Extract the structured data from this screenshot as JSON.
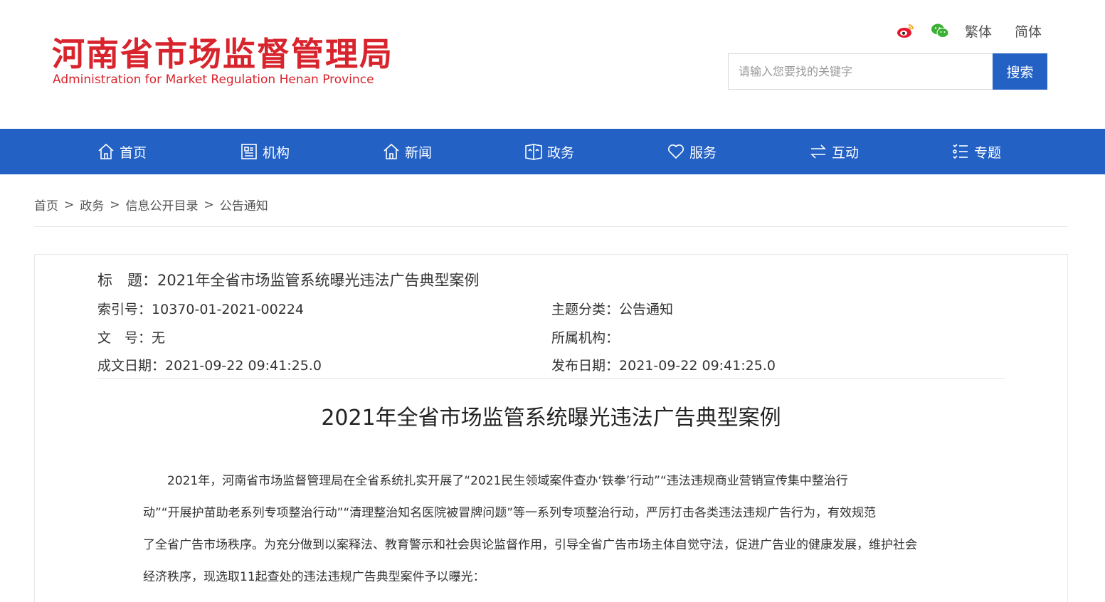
{
  "header": {
    "logo_cn": "河南省市场监督管理局",
    "logo_en": "Administration for Market Regulation Henan Province",
    "lang_traditional": "繁体",
    "lang_simplified": "简体",
    "search_placeholder": "请输入您要找的关键字",
    "search_button": "搜索"
  },
  "colors": {
    "brand_red": "#d8242c",
    "nav_blue": "#2361c5"
  },
  "nav": {
    "items": [
      {
        "label": "首页",
        "icon": "home-icon"
      },
      {
        "label": "机构",
        "icon": "document-icon"
      },
      {
        "label": "新闻",
        "icon": "news-home-icon"
      },
      {
        "label": "政务",
        "icon": "shield-badge-icon"
      },
      {
        "label": "服务",
        "icon": "heart-icon"
      },
      {
        "label": "互动",
        "icon": "exchange-arrows-icon"
      },
      {
        "label": "专题",
        "icon": "list-icon"
      }
    ]
  },
  "breadcrumb": {
    "items": [
      "首页",
      "政务",
      "信息公开目录",
      "公告通知"
    ],
    "separator": ">"
  },
  "meta": {
    "title_label": "标　题：",
    "title_value": "2021年全省市场监管系统曝光违法广告典型案例",
    "index_label": "索引号：",
    "index_value": "10370-01-2021-00224",
    "category_label": "主题分类：",
    "category_value": "公告通知",
    "docno_label": "文　号：",
    "docno_value": "无",
    "org_label": "所属机构：",
    "org_value": "",
    "created_label": "成文日期：",
    "created_value": "2021-09-22 09:41:25.0",
    "published_label": "发布日期：",
    "published_value": "2021-09-22 09:41:25.0"
  },
  "article": {
    "title": "2021年全省市场监管系统曝光违法广告典型案例",
    "lines": [
      "　　2021年，河南省市场监督管理局在全省系统扎实开展了“2021民生领域案件查办‘铁拳’行动”“违法违规商业营销宣传集中整治行",
      "动”“开展护苗助老系列专项整治行动”“清理整治知名医院被冒牌问题”等一系列专项整治行动，严厉打击各类违法违规广告行为，有效规范",
      "了全省广告市场秩序。为充分做到以案释法、教育警示和社会舆论监督作用，引导全省广告市场主体自觉守法，促进广告业的健康发展，维护社会",
      "经济秩序，现选取11起查处的违法违规广告典型案件予以曝光："
    ]
  }
}
